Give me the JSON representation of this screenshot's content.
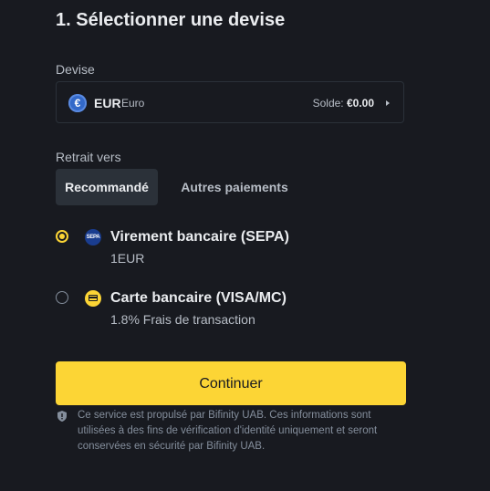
{
  "title": "1. Sélectionner une devise",
  "currency": {
    "label": "Devise",
    "code": "EUR",
    "name": "Euro",
    "icon_symbol": "€",
    "balance_label": "Solde:",
    "balance_value": "€0.00"
  },
  "withdraw": {
    "label": "Retrait vers",
    "tabs": [
      {
        "label": "Recommandé",
        "active": true
      },
      {
        "label": "Autres paiements",
        "active": false
      }
    ]
  },
  "options": [
    {
      "title": "Virement bancaire (SEPA)",
      "subtitle": "1EUR",
      "icon": "sepa-icon",
      "icon_text": "SEPA",
      "selected": true
    },
    {
      "title": "Carte bancaire (VISA/MC)",
      "subtitle": "1.8% Frais de transaction",
      "icon": "credit-card-icon",
      "selected": false
    }
  ],
  "continue_label": "Continuer",
  "disclaimer": "Ce service est propulsé par Bifinity UAB. Ces informations sont utilisées à des fins de vérification d'identité uniquement et seront conservées en sécurité par Bifinity UAB.",
  "colors": {
    "background": "#181a20",
    "accent": "#fcd535",
    "border": "#2b3139",
    "text_primary": "#eaecef",
    "text_secondary": "#b7bdc6",
    "text_muted": "#848e9c"
  }
}
